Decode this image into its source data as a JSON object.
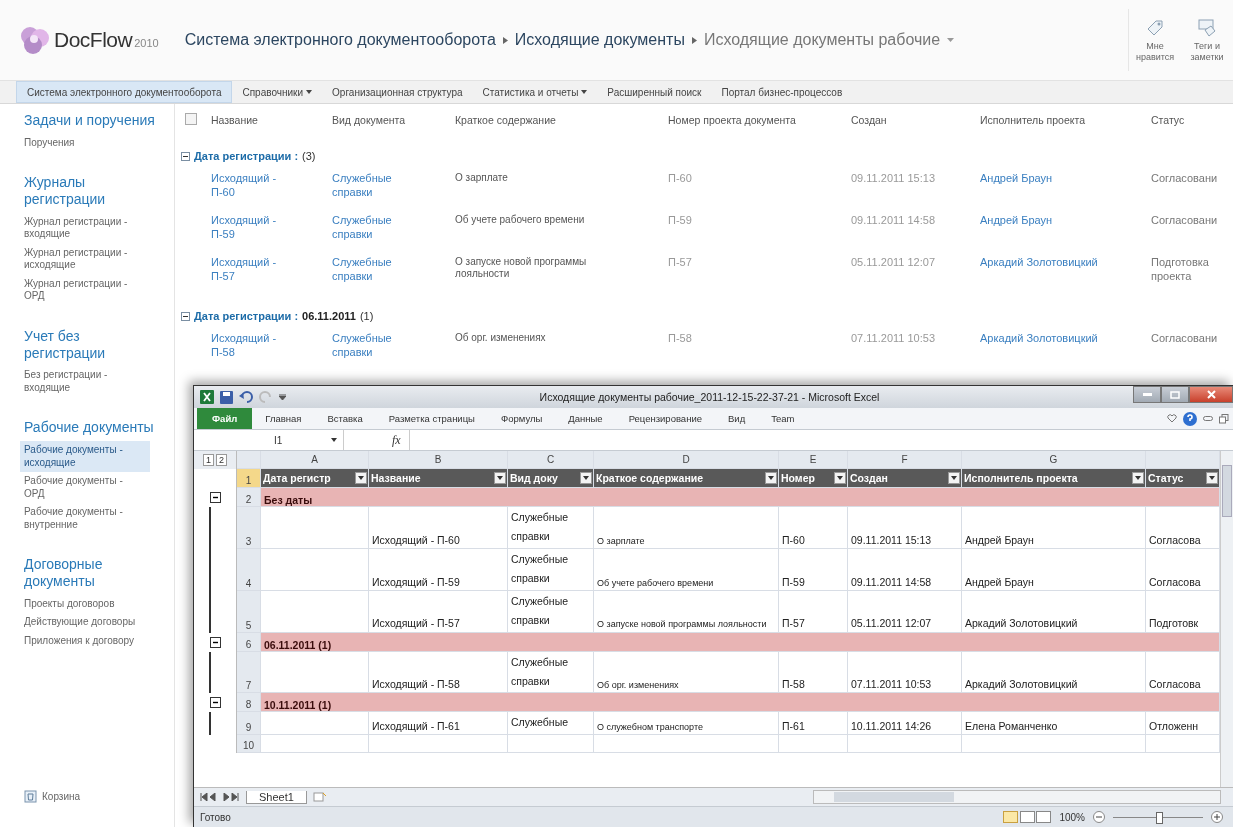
{
  "header": {
    "logo": {
      "name": "DocFlow",
      "version": "2010"
    },
    "breadcrumb": [
      {
        "label": "Система электронного документооборота",
        "kind": "link"
      },
      {
        "label": "Исходящие документы",
        "kind": "link"
      },
      {
        "label": "Исходящие документы рабочие",
        "kind": "current"
      }
    ],
    "actions": [
      {
        "label": "Мне нравится",
        "kind": "like"
      },
      {
        "label": "Теги и заметки",
        "kind": "tags"
      }
    ]
  },
  "top_nav": [
    {
      "label": "Система электронного документооборота",
      "selected": true,
      "has_menu": false
    },
    {
      "label": "Справочники",
      "selected": false,
      "has_menu": true
    },
    {
      "label": "Организационная структура",
      "selected": false,
      "has_menu": false
    },
    {
      "label": "Статистика и отчеты",
      "selected": false,
      "has_menu": true
    },
    {
      "label": "Расширенный поиск",
      "selected": false,
      "has_menu": false
    },
    {
      "label": "Портал бизнес-процессов",
      "selected": false,
      "has_menu": false
    }
  ],
  "sidebar": {
    "sections": [
      {
        "title": "Задачи и поручения",
        "items": [
          {
            "label": "Поручения",
            "selected": false
          }
        ]
      },
      {
        "title": "Журналы регистрации",
        "items": [
          {
            "label": "Журнал регистрации - входящие",
            "selected": false
          },
          {
            "label": "Журнал регистрации - исходящие",
            "selected": false
          },
          {
            "label": "Журнал регистрации - ОРД",
            "selected": false
          }
        ]
      },
      {
        "title": "Учет без регистрации",
        "items": [
          {
            "label": "Без регистрации - входящие",
            "selected": false
          }
        ]
      },
      {
        "title": "Рабочие документы",
        "items": [
          {
            "label": "Рабочие документы - исходящие",
            "selected": true
          },
          {
            "label": "Рабочие документы - ОРД",
            "selected": false
          },
          {
            "label": "Рабочие документы - внутренние",
            "selected": false
          }
        ]
      },
      {
        "title": "Договорные документы",
        "items": [
          {
            "label": "Проекты договоров",
            "selected": false
          },
          {
            "label": "Действующие договоры",
            "selected": false
          },
          {
            "label": "Приложения к договору",
            "selected": false
          }
        ]
      }
    ],
    "recycle_bin": "Корзина"
  },
  "list": {
    "select_all": {
      "checked": false
    },
    "columns": [
      "Название",
      "Вид документа",
      "Краткое содержание",
      "Номер проекта документа",
      "Создан",
      "Исполнитель проекта",
      "Статус"
    ],
    "groups": [
      {
        "label": "Дата регистрации :",
        "count": "(3)",
        "rows": [
          {
            "name": "Исходящий - П-60",
            "type": "Служебные справки",
            "summary": "О зарплате",
            "number": "П-60",
            "created": "09.11.2011 15:13",
            "author": "Андрей Браун",
            "status": "Согласовани"
          },
          {
            "name": "Исходящий - П-59",
            "type": "Служебные справки",
            "summary": "Об учете рабочего времени",
            "number": "П-59",
            "created": "09.11.2011 14:58",
            "author": "Андрей Браун",
            "status": "Согласовани"
          },
          {
            "name": "Исходящий - П-57",
            "type": "Служебные справки",
            "summary": "О запуске  новой программы лояльности",
            "number": "П-57",
            "created": "05.11.2011 12:07",
            "author": "Аркадий Золотовицкий",
            "status": "Подготовка проекта"
          }
        ]
      },
      {
        "label": "Дата регистрации :",
        "value": "06.11.2011",
        "count": "(1)",
        "rows": [
          {
            "name": "Исходящий - П-58",
            "type": "Служебные справки",
            "summary": "Об орг. изменениях",
            "number": "П-58",
            "created": "07.11.2011 10:53",
            "author": "Аркадий Золотовицкий",
            "status": "Согласовани"
          }
        ]
      }
    ]
  },
  "excel": {
    "title": "Исходящие документы рабочие_2011-12-15-22-37-21  -  Microsoft Excel",
    "tabs": [
      {
        "label": "Файл",
        "selected": true
      },
      {
        "label": "Главная",
        "selected": false
      },
      {
        "label": "Вставка",
        "selected": false
      },
      {
        "label": "Разметка страницы",
        "selected": false
      },
      {
        "label": "Формулы",
        "selected": false
      },
      {
        "label": "Данные",
        "selected": false
      },
      {
        "label": "Рецензирование",
        "selected": false
      },
      {
        "label": "Вид",
        "selected": false
      },
      {
        "label": "Team",
        "selected": false
      }
    ],
    "name_box": "I1",
    "fx": "fx",
    "outline_levels": [
      "1",
      "2"
    ],
    "column_letters": [
      "A",
      "B",
      "C",
      "D",
      "E",
      "F",
      "G"
    ],
    "header_row": {
      "num": "1",
      "cells": [
        "Дата регистр",
        "Название",
        "Вид доку",
        "Краткое содержание",
        "Номер",
        "Создан",
        "Исполнитель проекта",
        "Статус"
      ]
    },
    "rows": [
      {
        "kind": "group",
        "num": "2",
        "label": "Без даты"
      },
      {
        "kind": "data",
        "num": "3",
        "cells": [
          "",
          "Исходящий - П-60",
          "Служебные справки",
          "О зарплате",
          "П-60",
          "09.11.2011 15:13",
          "Андрей Браун",
          "Согласова"
        ]
      },
      {
        "kind": "data",
        "num": "4",
        "cells": [
          "",
          "Исходящий - П-59",
          "Служебные справки",
          "Об учете рабочего времени",
          "П-59",
          "09.11.2011 14:58",
          "Андрей Браун",
          "Согласова"
        ]
      },
      {
        "kind": "data",
        "num": "5",
        "cells": [
          "",
          "Исходящий - П-57",
          "Служебные справки",
          "О запуске  новой программы лояльности",
          "П-57",
          "05.11.2011 12:07",
          "Аркадий Золотовицкий",
          "Подготовк"
        ]
      },
      {
        "kind": "group",
        "num": "6",
        "label": "06.11.2011 (1)"
      },
      {
        "kind": "data",
        "num": "7",
        "cells": [
          "",
          "Исходящий - П-58",
          "Служебные справки",
          "Об орг. изменениях",
          "П-58",
          "07.11.2011 10:53",
          "Аркадий Золотовицкий",
          "Согласова"
        ]
      },
      {
        "kind": "group",
        "num": "8",
        "label": "10.11.2011 (1)"
      },
      {
        "kind": "data",
        "num": "9",
        "cells": [
          "",
          "Исходящий - П-61",
          "Служебные",
          "О служебном транспорте",
          "П-61",
          "10.11.2011 14:26",
          "Елена Романченко",
          "Отложенн"
        ]
      },
      {
        "kind": "empty",
        "num": "10"
      }
    ],
    "sheet_tab": {
      "label": "Sheet1"
    },
    "status": "Готово",
    "zoom": {
      "label": "100%",
      "level": 0.5
    }
  }
}
